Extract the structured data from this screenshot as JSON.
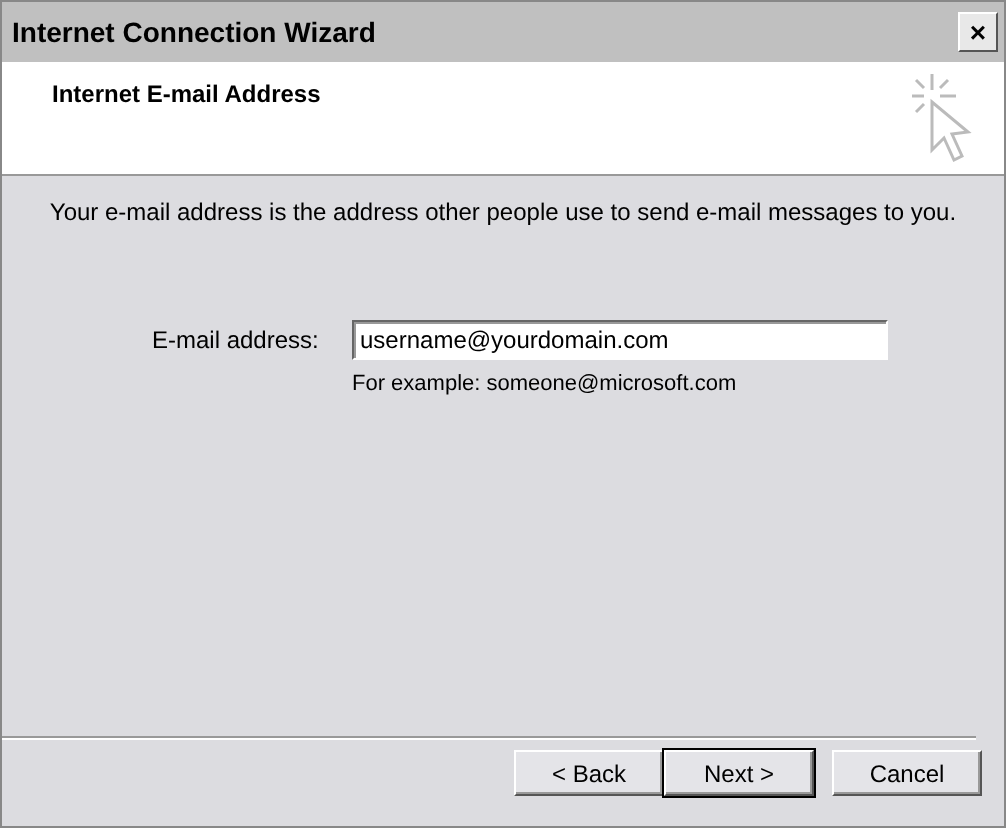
{
  "window": {
    "title": "Internet Connection Wizard",
    "close": "×"
  },
  "header": {
    "title": "Internet E-mail Address"
  },
  "description": "Your e-mail address is the address other people use to send e-mail messages to you.",
  "field": {
    "label": "E-mail address:",
    "value": "username@yourdomain.com",
    "hint": "For example: someone@microsoft.com"
  },
  "buttons": [
    {
      "label": "< Back",
      "default": false
    },
    {
      "label": "Next >",
      "default": true
    },
    {
      "label": "Cancel",
      "default": false
    }
  ]
}
